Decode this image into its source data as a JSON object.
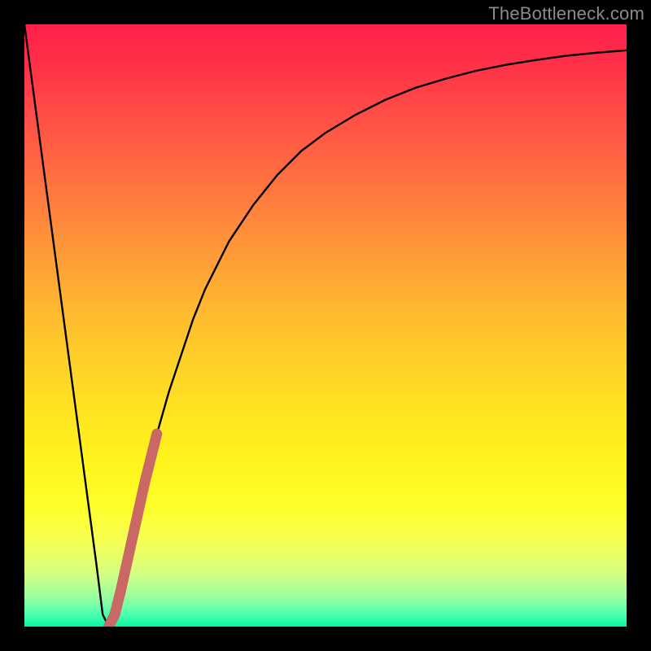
{
  "watermark": "TheBottleneck.com",
  "chart_data": {
    "type": "line",
    "title": "",
    "xlabel": "",
    "ylabel": "",
    "xlim": [
      0,
      100
    ],
    "ylim": [
      0,
      100
    ],
    "grid": false,
    "legend": false,
    "x": [
      0,
      2,
      4,
      6,
      8,
      10,
      12,
      13,
      14,
      15,
      16,
      18,
      20,
      22,
      24,
      26,
      28,
      30,
      34,
      38,
      42,
      46,
      50,
      55,
      60,
      65,
      70,
      75,
      80,
      85,
      90,
      95,
      100
    ],
    "series": [
      {
        "name": "bottleneck-curve",
        "values": [
          100,
          85,
          70,
          55,
          40,
          25,
          10,
          2,
          0,
          2,
          6,
          15,
          24,
          32,
          39,
          45,
          51,
          56,
          64,
          70,
          75,
          79,
          82,
          85,
          87.5,
          89.5,
          91,
          92.3,
          93.3,
          94.1,
          94.8,
          95.3,
          95.7
        ]
      },
      {
        "name": "highlight-segment",
        "values": [
          null,
          null,
          null,
          null,
          null,
          null,
          null,
          null,
          0,
          2,
          6,
          15,
          24,
          32,
          null,
          null,
          null,
          null,
          null,
          null,
          null,
          null,
          null,
          null,
          null,
          null,
          null,
          null,
          null,
          null,
          null,
          null,
          null
        ]
      }
    ],
    "colors": {
      "curve": "#000000",
      "highlight": "#c96864"
    }
  }
}
